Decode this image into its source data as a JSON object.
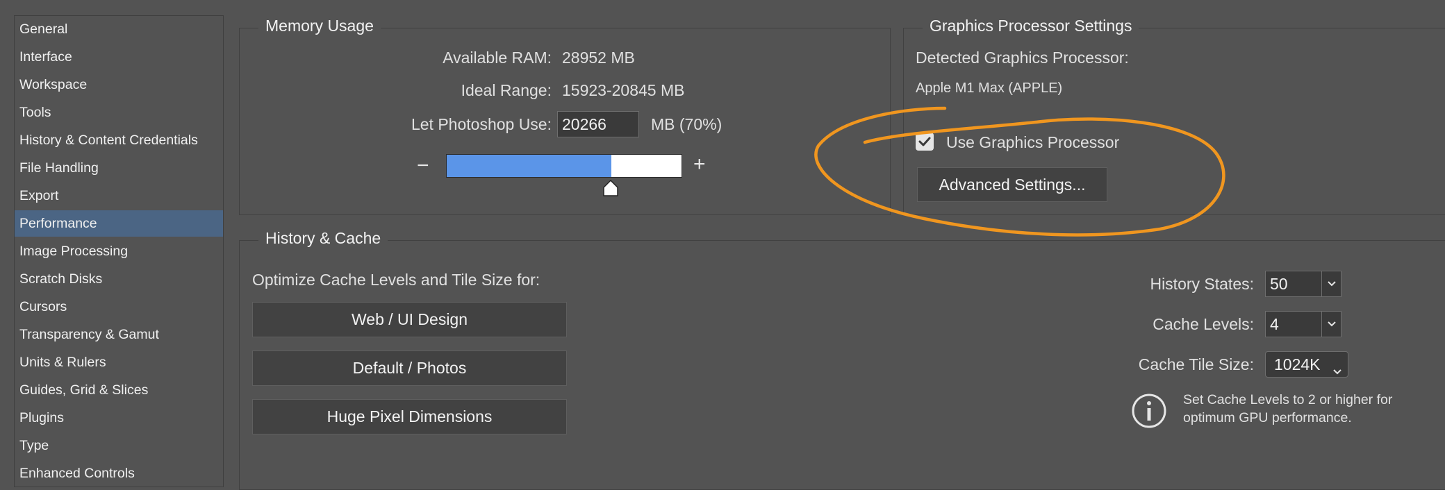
{
  "sidebar": {
    "items": [
      {
        "label": "General"
      },
      {
        "label": "Interface"
      },
      {
        "label": "Workspace"
      },
      {
        "label": "Tools"
      },
      {
        "label": "History & Content Credentials"
      },
      {
        "label": "File Handling"
      },
      {
        "label": "Export"
      },
      {
        "label": "Performance",
        "selected": true
      },
      {
        "label": "Image Processing"
      },
      {
        "label": "Scratch Disks"
      },
      {
        "label": "Cursors"
      },
      {
        "label": "Transparency & Gamut"
      },
      {
        "label": "Units & Rulers"
      },
      {
        "label": "Guides, Grid & Slices"
      },
      {
        "label": "Plugins"
      },
      {
        "label": "Type"
      },
      {
        "label": "Enhanced Controls"
      }
    ]
  },
  "memory": {
    "title": "Memory Usage",
    "available_label": "Available RAM:",
    "available_value": "28952 MB",
    "ideal_label": "Ideal Range:",
    "ideal_value": "15923-20845 MB",
    "use_label": "Let Photoshop Use:",
    "use_value": "20266",
    "use_unit": "MB (70%)",
    "slider_fraction": 0.7,
    "minus": "−",
    "plus": "+",
    "slider_color": "#5b95e8"
  },
  "gpu": {
    "title": "Graphics Processor Settings",
    "detected_label": "Detected Graphics Processor:",
    "detected_value": "Apple M1 Max (APPLE)",
    "use_gpu_label": "Use Graphics Processor",
    "use_gpu_checked": true,
    "advanced_button": "Advanced Settings...",
    "annotation_color": "#f0961f"
  },
  "history_cache": {
    "title": "History & Cache",
    "optimize_label": "Optimize Cache Levels and Tile Size for:",
    "buttons": [
      "Web / UI Design",
      "Default / Photos",
      "Huge Pixel Dimensions"
    ],
    "history_states_label": "History States:",
    "history_states_value": "50",
    "cache_levels_label": "Cache Levels:",
    "cache_levels_value": "4",
    "tile_size_label": "Cache Tile Size:",
    "tile_size_value": "1024K",
    "info_text_1": "Set Cache Levels to 2 or higher for",
    "info_text_2": "optimum GPU performance."
  }
}
